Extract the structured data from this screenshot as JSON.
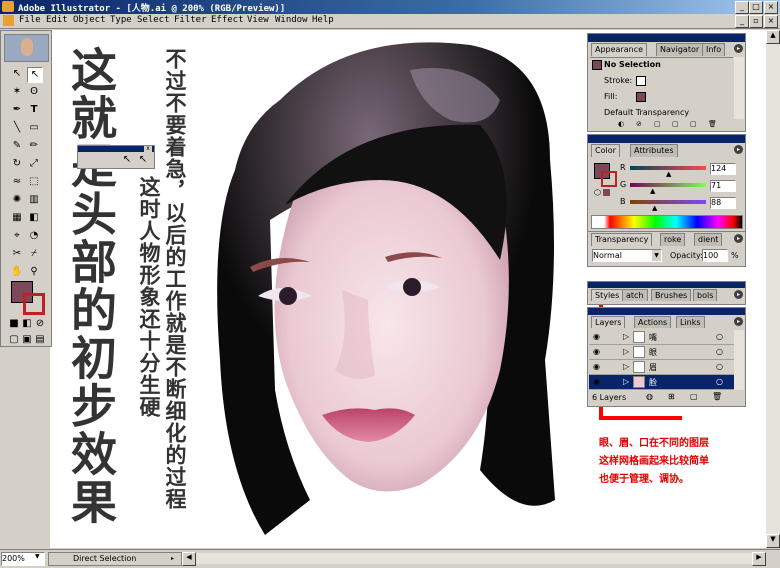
{
  "window": {
    "title": "Adobe Illustrator - [人物.ai @ 200% (RGB/Preview)]"
  },
  "menu": [
    "File",
    "Edit",
    "Object",
    "Type",
    "Select",
    "Filter",
    "Effect",
    "View",
    "Window",
    "Help"
  ],
  "canvas_text": {
    "title_big": "这就是头部的初步效果",
    "note_1": "不过不要着急，以后的工作就是不断细化的过程",
    "note_2": "这时人物形象还十分生硬",
    "red_note_1": "眼、眉、口在不同的图层",
    "red_note_2": "这样网格画起来比较简单",
    "red_note_3": "也便于管理、调协。"
  },
  "appearance_panel": {
    "tabs": [
      "Appearance",
      "Navigator",
      "Info"
    ],
    "header": "No Selection",
    "stroke_label": "Stroke:",
    "fill_label": "Fill:",
    "default_transparency": "Default Transparency"
  },
  "color_panel": {
    "tabs": [
      "Color",
      "Attributes"
    ],
    "r_label": "R",
    "r_value": "124",
    "g_label": "G",
    "g_value": "71",
    "b_label": "B",
    "b_value": "88",
    "fill_color": "#7c4758"
  },
  "transparency_panel": {
    "tabs": [
      "Transparency",
      "roke",
      "dient"
    ],
    "blend_mode": "Normal",
    "opacity_label": "Opacity:",
    "opacity_value": "100",
    "opacity_unit": "%"
  },
  "styles_panel": {
    "tabs": [
      "Styles",
      "atch",
      "Brushes",
      "bols"
    ]
  },
  "layers_panel": {
    "tabs": [
      "Layers",
      "Actions",
      "Links"
    ],
    "layers": [
      "嘴",
      "眼",
      "眉",
      "脸"
    ],
    "count_label": "6 Layers"
  },
  "status": {
    "zoom": "200%",
    "tool": "Direct Selection"
  },
  "floating_toolbar": {
    "close": "x"
  }
}
